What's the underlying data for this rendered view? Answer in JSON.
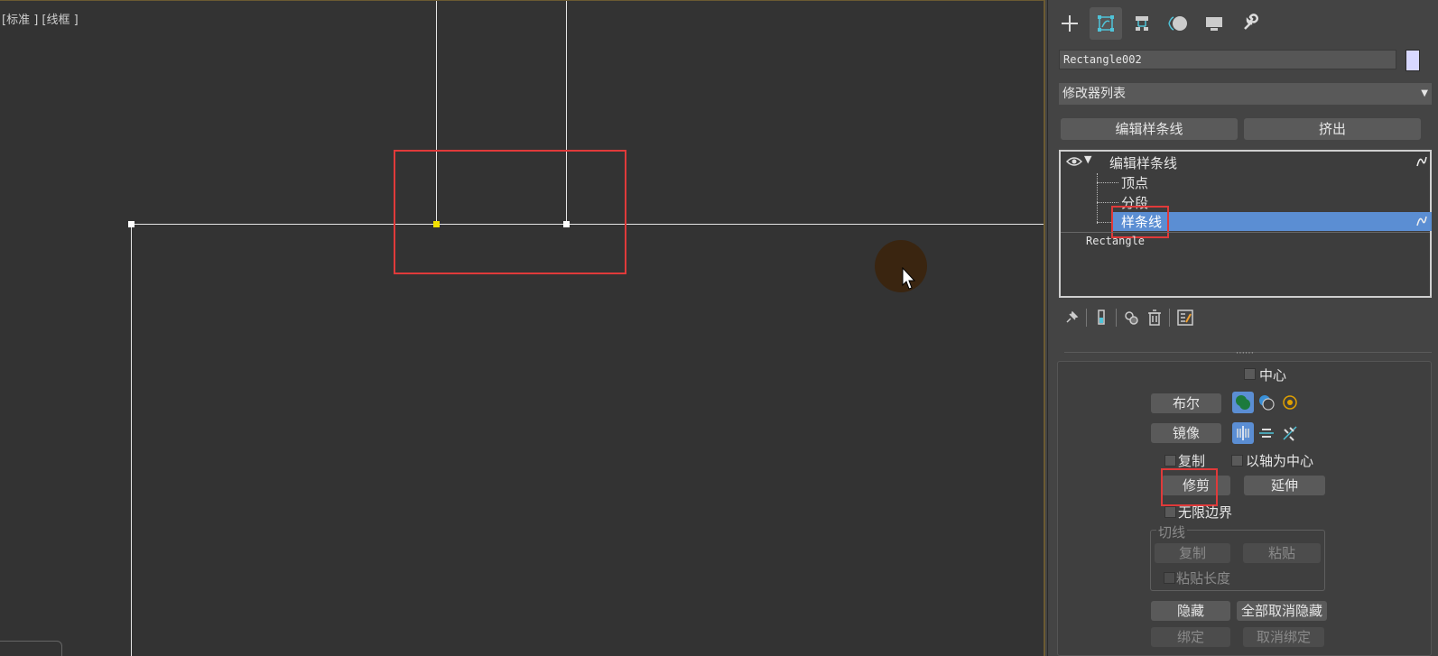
{
  "viewport": {
    "label": "[标准 ] [线框 ]"
  },
  "panel": {
    "tabs": [
      {
        "name": "create",
        "icon": "plus-icon"
      },
      {
        "name": "modify",
        "icon": "modify-icon",
        "active": true
      },
      {
        "name": "hierarchy",
        "icon": "hierarchy-icon"
      },
      {
        "name": "motion",
        "icon": "motion-icon"
      },
      {
        "name": "display",
        "icon": "display-icon"
      },
      {
        "name": "utilities",
        "icon": "wrench-icon"
      }
    ],
    "object_name": "Rectangle002",
    "object_color": "#d8d8ff",
    "modifier_list": "修改器列表",
    "quick_buttons": {
      "edit_spline": "编辑样条线",
      "extrude": "挤出"
    },
    "stack": {
      "modifier": "编辑样条线",
      "sub_vertex": "顶点",
      "sub_segment": "分段",
      "sub_spline": "样条线",
      "base": "Rectangle"
    },
    "rollout": {
      "center_label": "中心",
      "boolean_label": "布尔",
      "mirror_label": "镜像",
      "copy_label": "复制",
      "about_pivot_label": "以轴为中心",
      "trim_label": "修剪",
      "extend_label": "延伸",
      "infinite_bounds_label": "无限边界",
      "tangent_group": "切线",
      "tangent_copy": "复制",
      "tangent_paste": "粘贴",
      "paste_length": "粘贴长度",
      "hide_label": "隐藏",
      "unhide_all_label": "全部取消隐藏",
      "bind_label": "绑定",
      "unbind_label": "取消绑定"
    }
  }
}
